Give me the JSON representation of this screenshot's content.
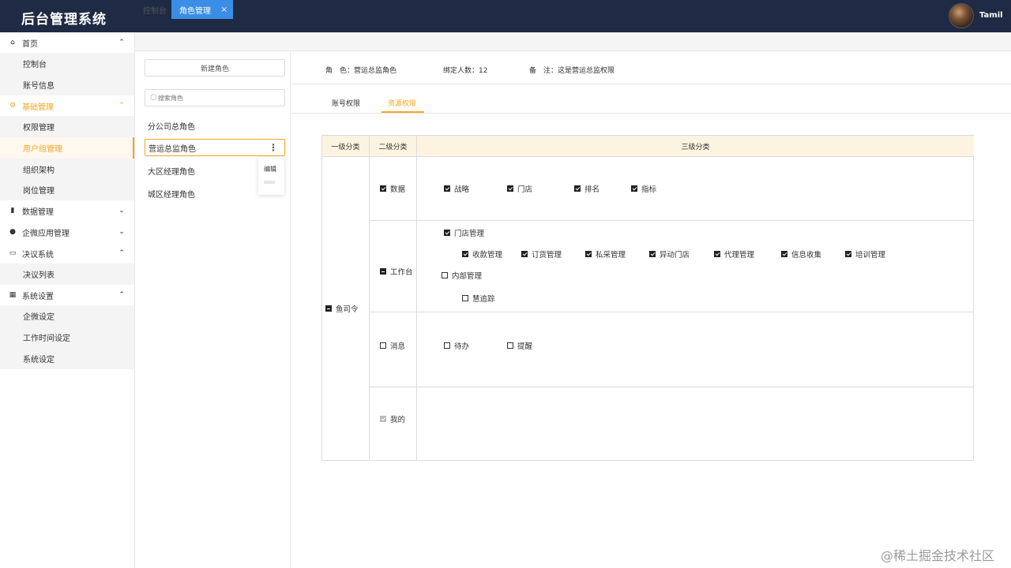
{
  "app": {
    "title": "后台管理系统",
    "username": "Tamil"
  },
  "sidebar": {
    "groups": [
      {
        "label": "首页",
        "icon": "home-icon",
        "expanded": true,
        "items": [
          "控制台",
          "账号信息"
        ]
      },
      {
        "label": "基础管理",
        "icon": "gear-icon",
        "expanded": true,
        "active": true,
        "items": [
          "权限管理",
          "用户组管理",
          "组织架构",
          "岗位管理"
        ],
        "active_item": "用户组管理"
      },
      {
        "label": "数据管理",
        "icon": "chart-icon",
        "expanded": false
      },
      {
        "label": "企微应用管理",
        "icon": "wechat-icon",
        "expanded": false
      },
      {
        "label": "决议系统",
        "icon": "list-icon",
        "expanded": true,
        "items": [
          "决议列表"
        ]
      },
      {
        "label": "系统设置",
        "icon": "grid-icon",
        "expanded": true,
        "items": [
          "企微设定",
          "工作时间设定",
          "系统设定"
        ]
      }
    ]
  },
  "tabs": {
    "console": "控制台",
    "current": "角色管理",
    "close": "×"
  },
  "role_panel": {
    "new_role": "新建角色",
    "search_placeholder": "搜索角色",
    "roles": [
      "分公司总角色",
      "营运总监角色",
      "大区经理角色",
      "城区经理角色"
    ],
    "selected": "营运总监角色",
    "context_menu": {
      "edit": "编辑"
    }
  },
  "info": {
    "role_label": "角　色：",
    "role_value": "营运总监角色",
    "count_label": "绑定人数：",
    "count_value": "12",
    "note_label": "备　注：",
    "note_value": "这是营运总监权限"
  },
  "subtabs": {
    "account": "账号权限",
    "resource": "资源权限",
    "active": "资源权限"
  },
  "permissions": {
    "headers": {
      "l1": "一级分类",
      "l2": "二级分类",
      "l3": "三级分类"
    },
    "root": {
      "label": "鱼司令",
      "state": "partial"
    },
    "data": {
      "label": "数据",
      "state": "checked",
      "items": [
        "战略",
        "门店",
        "排名",
        "指标"
      ]
    },
    "workbench": {
      "label": "工作台",
      "state": "partial",
      "store_mgmt": {
        "label": "门店管理",
        "state": "checked",
        "items": [
          "收款管理",
          "订货管理",
          "私采管理",
          "异动门店",
          "代理管理",
          "信息收集",
          "培训管理"
        ]
      },
      "internal_mgmt": {
        "label": "内部管理",
        "state": "unchecked",
        "items": [
          "慧追踪"
        ]
      }
    },
    "message": {
      "label": "消息",
      "state": "unchecked",
      "items": [
        "待办",
        "提醒"
      ]
    },
    "mine": {
      "label": "我的",
      "state": "disabled"
    }
  },
  "watermark": "@稀土掘金技术社区"
}
